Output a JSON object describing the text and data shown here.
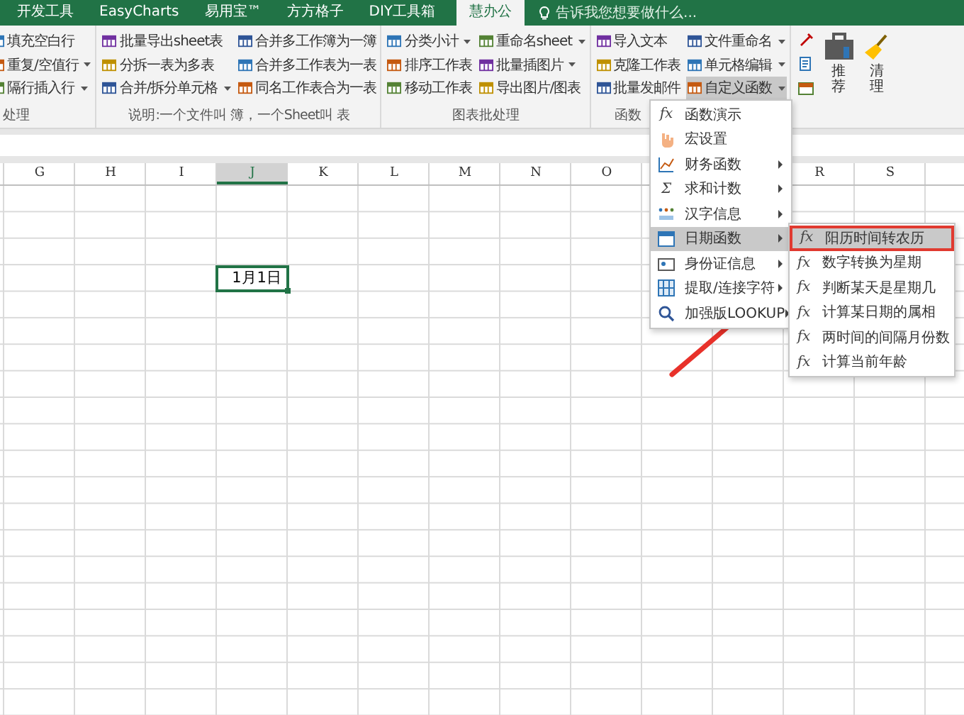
{
  "tabs": [
    {
      "label": "开发工具",
      "selected": false
    },
    {
      "label": "EasyCharts",
      "selected": false
    },
    {
      "label": "易用宝™",
      "selected": false
    },
    {
      "label": "方方格子",
      "selected": false
    },
    {
      "label": "DIY工具箱",
      "selected": false
    },
    {
      "label": "慧办公",
      "selected": true
    }
  ],
  "tell_me": {
    "placeholder": "告诉我您想要做什么..."
  },
  "ribbon_groups": [
    {
      "kind": "small",
      "label": "处理",
      "columns": [
        [
          {
            "label": "填充空白行",
            "dropdown": false,
            "pressed": false
          },
          {
            "label": "重复/空值行",
            "dropdown": true,
            "pressed": false
          },
          {
            "label": "隔行插入行",
            "dropdown": true,
            "pressed": false
          }
        ]
      ]
    },
    {
      "kind": "small",
      "label": "说明:一个文件叫 簿，一个Sheet叫 表",
      "columns": [
        [
          {
            "label": "批量导出sheet表",
            "dropdown": false,
            "pressed": false
          },
          {
            "label": "分拆一表为多表",
            "dropdown": false,
            "pressed": false
          },
          {
            "label": "合并/拆分单元格",
            "dropdown": true,
            "pressed": false
          }
        ],
        [
          {
            "label": "合并多工作簿为一簿",
            "dropdown": false,
            "pressed": false
          },
          {
            "label": "合并多工作表为一表",
            "dropdown": false,
            "pressed": false
          },
          {
            "label": "同名工作表合为一表",
            "dropdown": false,
            "pressed": false
          }
        ]
      ]
    },
    {
      "kind": "small",
      "label": "图表批处理",
      "columns": [
        [
          {
            "label": "分类小计",
            "dropdown": true,
            "pressed": false
          },
          {
            "label": "排序工作表",
            "dropdown": false,
            "pressed": false
          },
          {
            "label": "移动工作表",
            "dropdown": false,
            "pressed": false
          }
        ],
        [
          {
            "label": "重命名sheet",
            "dropdown": true,
            "pressed": false
          },
          {
            "label": "批量插图片",
            "dropdown": true,
            "pressed": false
          },
          {
            "label": "导出图片/图表",
            "dropdown": false,
            "pressed": false
          }
        ]
      ]
    },
    {
      "kind": "small",
      "label": "函数",
      "columns": [
        [
          {
            "label": "导入文本",
            "dropdown": false,
            "pressed": false
          },
          {
            "label": "克隆工作表",
            "dropdown": false,
            "pressed": false
          },
          {
            "label": "批量发邮件",
            "dropdown": false,
            "pressed": false
          }
        ],
        [
          {
            "label": "文件重命名",
            "dropdown": true,
            "pressed": false
          },
          {
            "label": "单元格编辑",
            "dropdown": true,
            "pressed": false
          },
          {
            "label": "自定义函数",
            "dropdown": true,
            "pressed": true
          }
        ]
      ]
    },
    {
      "kind": "large",
      "buttons": [
        {
          "label": "推荐"
        },
        {
          "label": "清理"
        }
      ]
    }
  ],
  "columns": [
    {
      "label": "G",
      "selected": false
    },
    {
      "label": "H",
      "selected": false
    },
    {
      "label": "I",
      "selected": false
    },
    {
      "label": "J",
      "selected": true
    },
    {
      "label": "K",
      "selected": false
    },
    {
      "label": "L",
      "selected": false
    },
    {
      "label": "M",
      "selected": false
    },
    {
      "label": "N",
      "selected": false
    },
    {
      "label": "O",
      "selected": false
    }
  ],
  "columns_right": [
    {
      "label": "R",
      "selected": false
    },
    {
      "label": "S",
      "selected": false
    }
  ],
  "active_cell": {
    "value": "1月1日"
  },
  "menu": [
    {
      "glyph": "fx",
      "label": "函数演示",
      "submenu": false,
      "selected": false
    },
    {
      "label": "宏设置",
      "submenu": false,
      "selected": false
    },
    {
      "label": "财务函数",
      "submenu": true,
      "selected": false
    },
    {
      "glyph": "Σ",
      "label": "求和计数",
      "submenu": true,
      "selected": false
    },
    {
      "label": "汉字信息",
      "submenu": true,
      "selected": false
    },
    {
      "label": "日期函数",
      "submenu": true,
      "selected": true
    },
    {
      "label": "身份证信息",
      "submenu": true,
      "selected": false
    },
    {
      "label": "提取/连接字符",
      "submenu": true,
      "selected": false
    },
    {
      "label": "加强版LOOKUP",
      "submenu": true,
      "selected": false
    }
  ],
  "submenu": [
    {
      "glyph": "fx",
      "label": "阳历时间转农历",
      "selected": true,
      "annotated": true
    },
    {
      "glyph": "fx",
      "label": "数字转换为星期",
      "selected": false,
      "annotated": false
    },
    {
      "glyph": "fx",
      "label": "判断某天是星期几",
      "selected": false,
      "annotated": false
    },
    {
      "glyph": "fx",
      "label": "计算某日期的属相",
      "selected": false,
      "annotated": false
    },
    {
      "glyph": "fx",
      "label": "两时间的间隔月份数",
      "selected": false,
      "annotated": false
    },
    {
      "glyph": "fx",
      "label": "计算当前年龄",
      "selected": false,
      "annotated": false
    }
  ],
  "annotation": {
    "kind": "arrow"
  }
}
